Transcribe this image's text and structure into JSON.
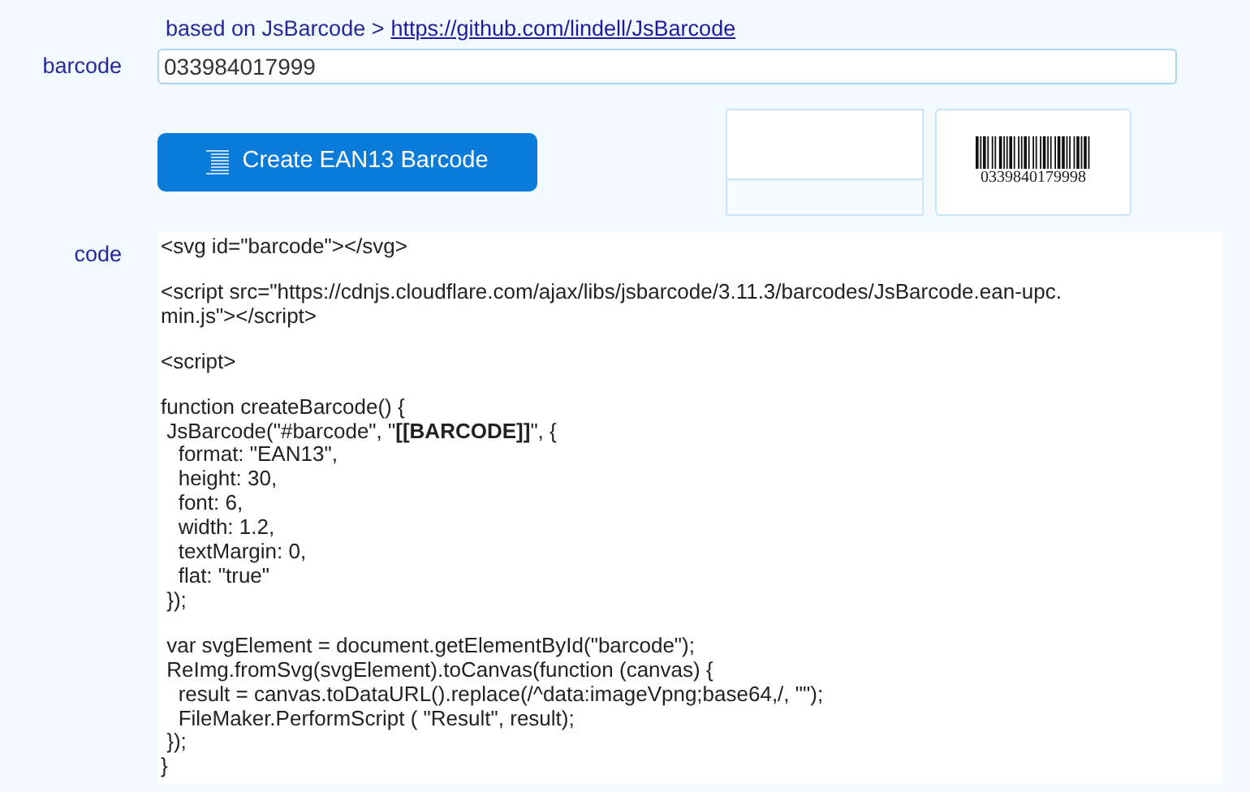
{
  "header": {
    "text": "based on JsBarcode >",
    "link": "https://github.com/lindell/JsBarcode"
  },
  "barcode_field": {
    "label": "barcode",
    "value": "033984017999"
  },
  "create_button": {
    "label": "Create EAN13 Barcode"
  },
  "preview": {
    "barcode_number": "0339840179998"
  },
  "code": {
    "label": "code",
    "blocks": [
      [
        "<svg id=\"barcode\"></svg>"
      ],
      [
        "<script src=\"https://cdnjs.cloudflare.com/ajax/libs/jsbarcode/3.11.3/barcodes/JsBarcode.ean-upc.",
        "min.js\"></script>"
      ],
      [
        "<script>"
      ],
      [
        "function createBarcode() {",
        " JsBarcode(\"#barcode\", \"**[[BARCODE]]**\", {",
        "   format: \"EAN13\",",
        "   height: 30,",
        "   font: 6,",
        "   width: 1.2,",
        "   textMargin: 0,",
        "   flat: \"true\"",
        " });"
      ],
      [
        " var svgElement = document.getElementById(\"barcode\");",
        " ReImg.fromSvg(svgElement).toCanvas(function (canvas) {",
        "   result = canvas.toDataURL().replace(/^data:imageVpng;base64,/, \"\");",
        "   FileMaker.PerformScript ( \"Result\", result);",
        " });",
        "}"
      ]
    ]
  }
}
